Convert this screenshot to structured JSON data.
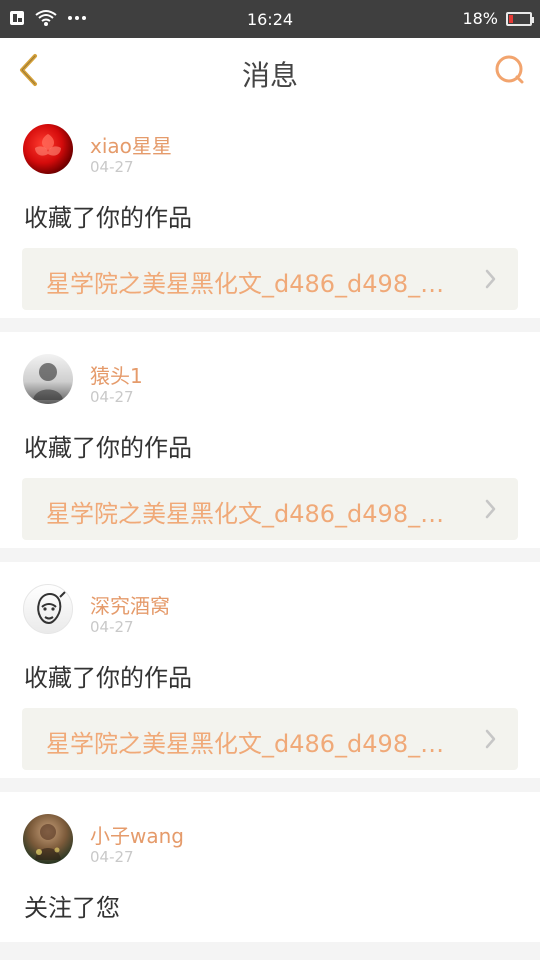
{
  "status": {
    "time": "16:24",
    "battery": "18%"
  },
  "header": {
    "title": "消息"
  },
  "colors": {
    "accent": "#e59b6b",
    "link": "#f0a978",
    "back_icon": "#d6a23a"
  },
  "messages": [
    {
      "username": "xiao星星",
      "date": "04-27",
      "action": "收藏了你的作品",
      "work_title": "星学院之美星黑化文_d486_d498_…"
    },
    {
      "username": "猿头1",
      "date": "04-27",
      "action": "收藏了你的作品",
      "work_title": "星学院之美星黑化文_d486_d498_…"
    },
    {
      "username": "深究酒窝",
      "date": "04-27",
      "action": "收藏了你的作品",
      "work_title": "星学院之美星黑化文_d486_d498_…"
    },
    {
      "username": "小子wang",
      "date": "04-27",
      "action": "关注了您",
      "work_title": ""
    }
  ]
}
